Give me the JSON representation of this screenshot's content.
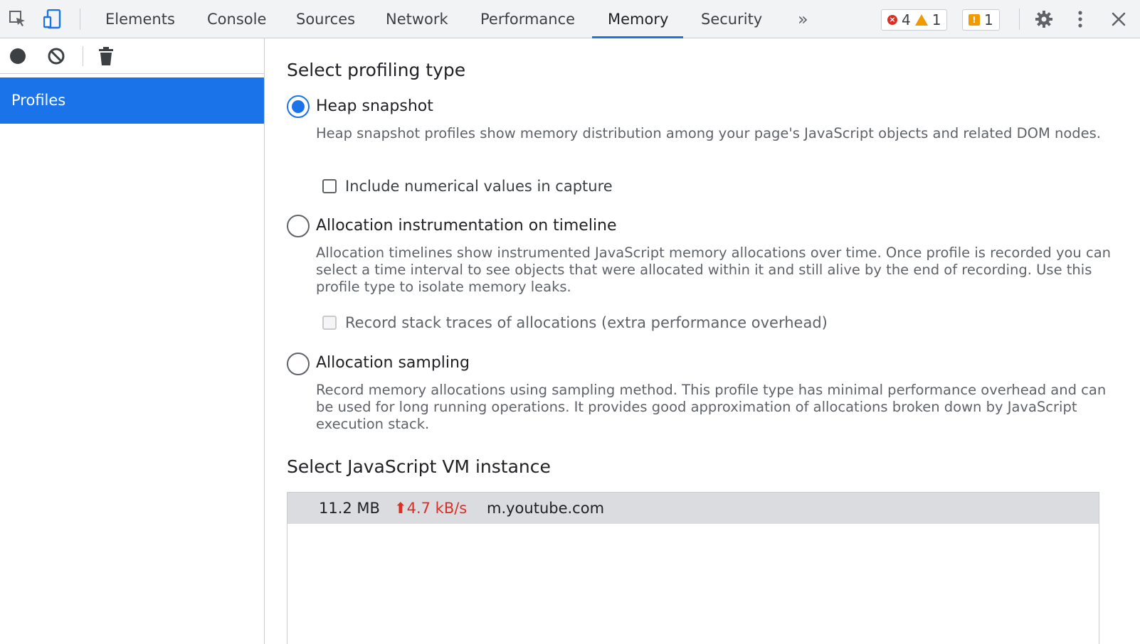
{
  "toolbar": {
    "tabs": [
      {
        "label": "Elements"
      },
      {
        "label": "Console"
      },
      {
        "label": "Sources"
      },
      {
        "label": "Network"
      },
      {
        "label": "Performance"
      },
      {
        "label": "Memory"
      },
      {
        "label": "Security"
      }
    ],
    "active_tab": "Memory",
    "more_tabs": "»",
    "errors_count": "4",
    "warnings_count": "1",
    "issues_count": "1",
    "icons": {
      "inspect": "inspect-element-icon",
      "device": "device-toolbar-icon",
      "settings": "gear-icon",
      "more": "kebab-menu-icon",
      "close": "close-icon"
    }
  },
  "sidebar": {
    "buttons": [
      "record-icon",
      "clear-icon",
      "trash-icon"
    ],
    "items": [
      {
        "label": "Profiles"
      }
    ]
  },
  "main": {
    "profiling_title": "Select profiling type",
    "options": [
      {
        "label": "Heap snapshot",
        "checked": true,
        "description": "Heap snapshot profiles show memory distribution among your page's JavaScript objects and related DOM nodes.",
        "checkbox_label": "Include numerical values in capture",
        "checkbox_checked": false,
        "checkbox_disabled": false
      },
      {
        "label": "Allocation instrumentation on timeline",
        "checked": false,
        "description": "Allocation timelines show instrumented JavaScript memory allocations over time. Once profile is recorded you can select a time interval to see objects that were allocated within it and still alive by the end of recording. Use this profile type to isolate memory leaks.",
        "checkbox_label": "Record stack traces of allocations (extra performance overhead)",
        "checkbox_checked": false,
        "checkbox_disabled": true
      },
      {
        "label": "Allocation sampling",
        "checked": false,
        "description": "Record memory allocations using sampling method. This profile type has minimal performance overhead and can be used for long running operations. It provides good approximation of allocations broken down by JavaScript execution stack."
      }
    ],
    "vm_title": "Select JavaScript VM instance",
    "vm_instances": [
      {
        "size": "11.2 MB",
        "rate": "⬆4.7 kB/s",
        "url": "m.youtube.com"
      }
    ]
  },
  "colors": {
    "accent": "#1a73e8",
    "error": "#d93025",
    "warning": "#f29900"
  }
}
